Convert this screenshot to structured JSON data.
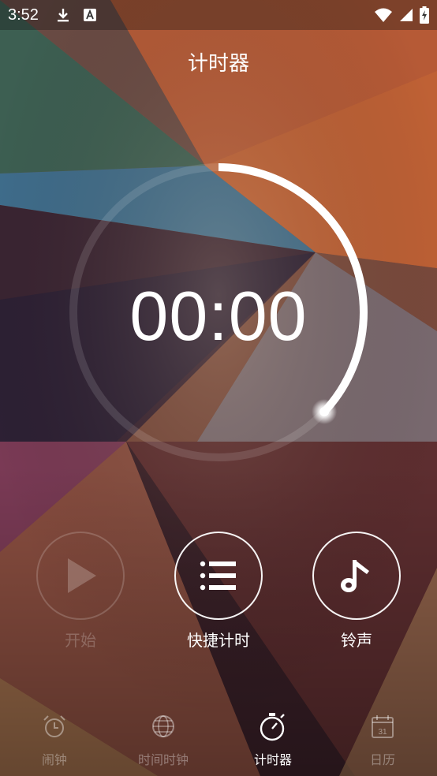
{
  "status_bar": {
    "time": "3:52",
    "icons_left": [
      "download-icon",
      "keyboard-a-icon"
    ],
    "icons_right": [
      "wifi-icon",
      "signal-icon",
      "battery-charging-icon"
    ]
  },
  "header": {
    "title": "计时器"
  },
  "timer": {
    "display": "00:00",
    "progress": 0.37,
    "ring_color": "#ffffff"
  },
  "controls": {
    "start": {
      "label": "开始",
      "icon": "play-icon",
      "enabled": false
    },
    "quick": {
      "label": "快捷计时",
      "icon": "list-icon",
      "enabled": true
    },
    "ringtone": {
      "label": "铃声",
      "icon": "music-note-icon",
      "enabled": true
    }
  },
  "bottom_nav": {
    "items": [
      {
        "label": "闹钟",
        "icon": "alarm-clock-icon",
        "active": false
      },
      {
        "label": "时间时钟",
        "icon": "globe-icon",
        "active": false
      },
      {
        "label": "计时器",
        "icon": "stopwatch-icon",
        "active": true
      },
      {
        "label": "日历",
        "icon": "calendar-icon",
        "active": false,
        "icon_text": "31"
      }
    ]
  }
}
